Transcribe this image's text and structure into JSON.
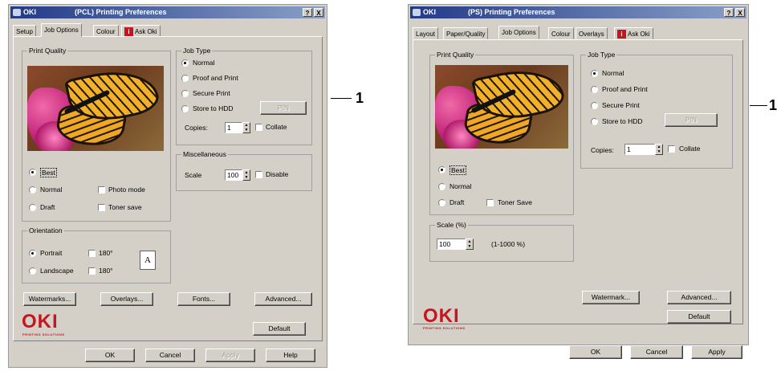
{
  "dialog1": {
    "app_label": "OKI",
    "title": "(PCL) Printing Preferences",
    "help_btn": "?",
    "close_btn": "X",
    "tabs": [
      "Setup",
      "Job Options",
      "Colour",
      "Ask Oki"
    ],
    "print_quality": {
      "label": "Print Quality",
      "options": [
        "Best",
        "Normal",
        "Draft"
      ],
      "selected": "Best",
      "checkboxes": [
        "Photo mode",
        "Toner save"
      ]
    },
    "job_type": {
      "label": "Job Type",
      "options": [
        "Normal",
        "Proof and Print",
        "Secure Print",
        "Store to HDD"
      ],
      "selected": "Normal",
      "pin_button": "PIN",
      "copies_label": "Copies:",
      "copies_value": "1",
      "collate_label": "Collate"
    },
    "misc": {
      "label": "Miscellaneous",
      "scale_label": "Scale",
      "scale_value": "100",
      "disable_label": "Disable"
    },
    "orientation": {
      "label": "Orientation",
      "options": [
        "Portrait",
        "Landscape"
      ],
      "selected": "Portrait",
      "rotate_labels": [
        "180°",
        "180°"
      ],
      "icon_letter": "A"
    },
    "action_buttons": [
      "Watermarks...",
      "Overlays...",
      "Fonts...",
      "Advanced..."
    ],
    "logo": "OKI",
    "logo_tagline": "PRINTING SOLUTIONS",
    "default_button": "Default",
    "footer_buttons": [
      "OK",
      "Cancel",
      "Apply",
      "Help"
    ]
  },
  "dialog2": {
    "app_label": "OKI",
    "title": "(PS) Printing Preferences",
    "help_btn": "?",
    "close_btn": "X",
    "tabs": [
      "Layout",
      "Paper/Quality",
      "Job Options",
      "Colour",
      "Overlays",
      "Ask Oki"
    ],
    "print_quality": {
      "label": "Print Quality",
      "options": [
        "Best",
        "Normal",
        "Draft"
      ],
      "selected": "Best",
      "toner_save": "Toner Save"
    },
    "job_type": {
      "label": "Job Type",
      "options": [
        "Normal",
        "Proof and Print",
        "Secure Print",
        "Store to HDD"
      ],
      "selected": "Normal",
      "pin_button": "PIN",
      "copies_label": "Copies:",
      "copies_value": "1",
      "collate_label": "Collate"
    },
    "scale": {
      "label": "Scale (%)",
      "value": "100",
      "range": "(1-1000 %)"
    },
    "action_buttons": [
      "Watermark...",
      "Advanced..."
    ],
    "default_button": "Default",
    "logo": "OKI",
    "logo_tagline": "PRINTING SOLUTIONS",
    "footer_buttons": [
      "OK",
      "Cancel",
      "Apply"
    ]
  },
  "callouts": [
    "1",
    "1"
  ],
  "colors": {
    "face": "#d4d0c8",
    "titlebar": "#223a88",
    "oki_red": "#c8141e"
  }
}
